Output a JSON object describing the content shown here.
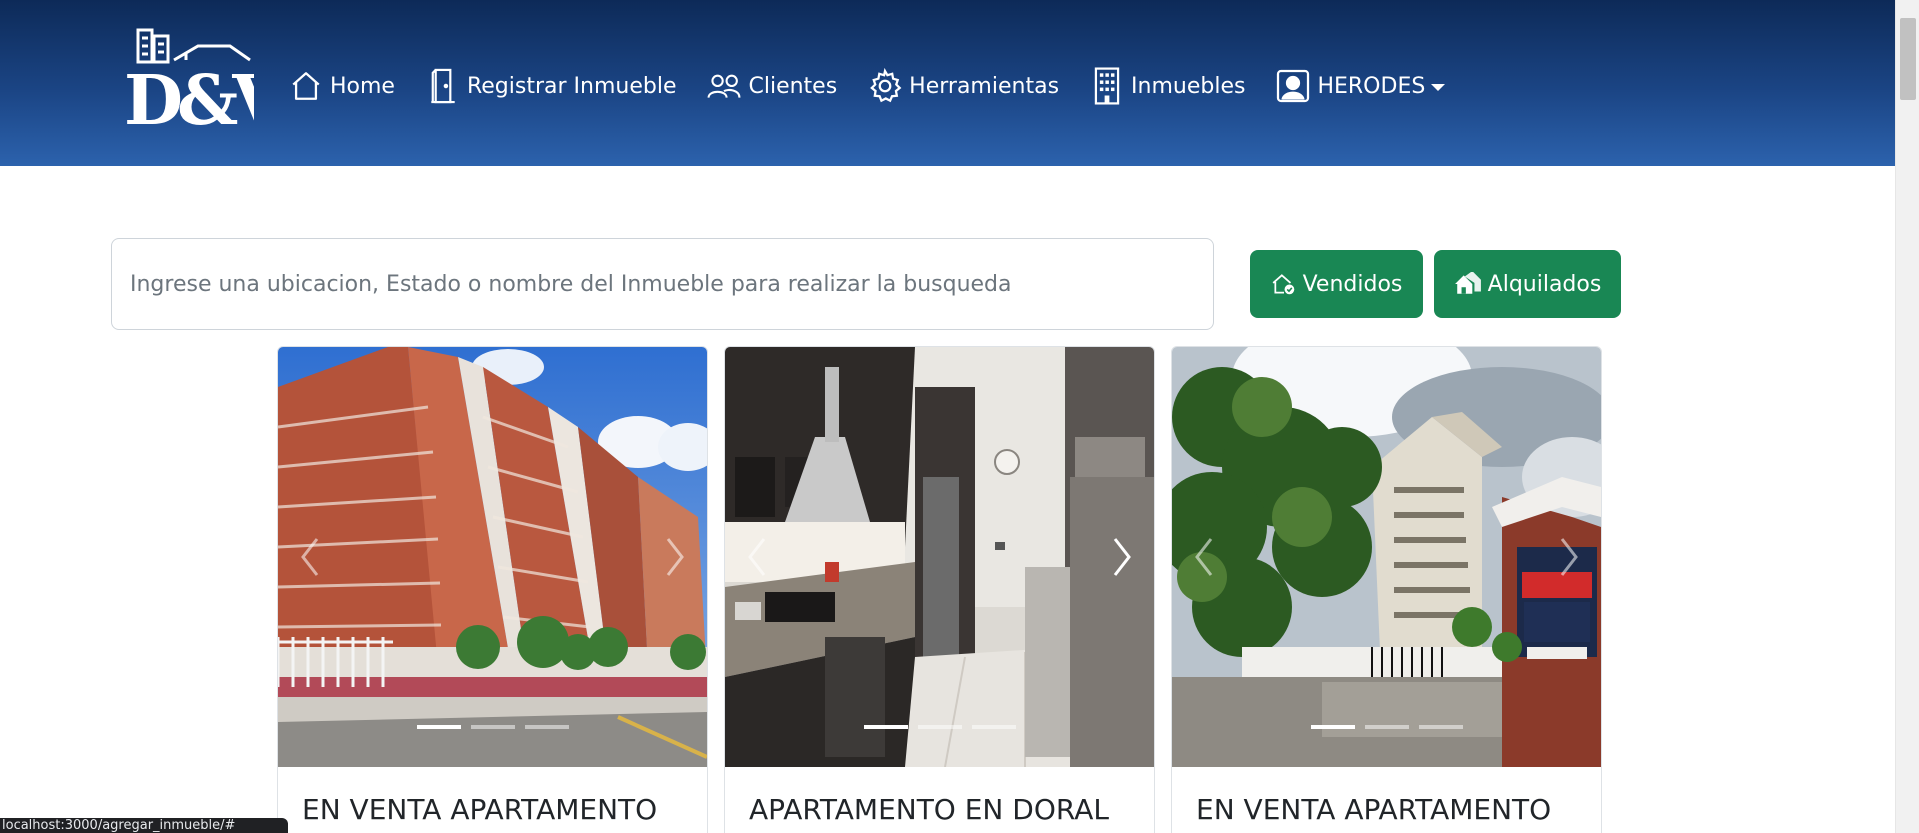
{
  "brand": {
    "logo_text": "D&V"
  },
  "nav": {
    "items": [
      {
        "label": "Home",
        "icon": "house-icon"
      },
      {
        "label": "Registrar Inmueble",
        "icon": "door-icon"
      },
      {
        "label": "Clientes",
        "icon": "people-icon"
      },
      {
        "label": "Herramientas",
        "icon": "gear-icon"
      },
      {
        "label": "Inmuebles",
        "icon": "building-icon"
      }
    ],
    "user": {
      "label": "HERODES",
      "icon": "person-badge-icon"
    }
  },
  "search": {
    "placeholder": "Ingrese una ubicacion, Estado o nombre del Inmueble para realizar la busqueda",
    "value": ""
  },
  "filters": {
    "sold_label": "Vendidos",
    "sold_icon": "house-check-icon",
    "rented_label": "Alquilados",
    "rented_icon": "houses-icon"
  },
  "listings": [
    {
      "title": "EN VENTA APARTAMENTO",
      "image": "high-rise brick apartment buildings",
      "active_slide": 1,
      "slide_count": 3
    },
    {
      "title": "APARTAMENTO EN DORAL",
      "image": "modern kitchen interior",
      "active_slide": 1,
      "slide_count": 3
    },
    {
      "title": "EN VENTA APARTAMENTO",
      "image": "apartment tower with trees and EN VENTA sign",
      "active_slide": 1,
      "slide_count": 3
    }
  ],
  "status_bar": {
    "url": "localhost:3000/agregar_inmueble/#"
  },
  "colors": {
    "header_top": "#0d2a58",
    "header_bottom": "#2c62ad",
    "button_green": "#198754"
  }
}
